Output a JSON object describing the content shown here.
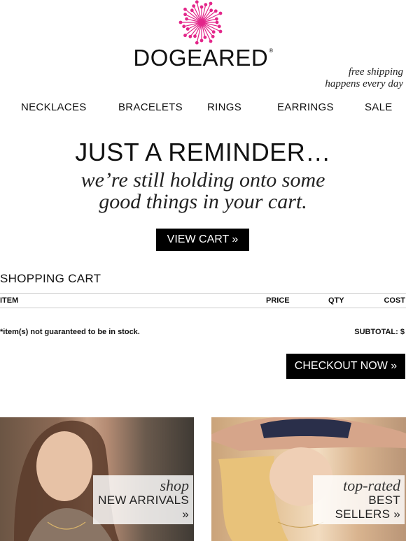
{
  "brand": {
    "name": "DOGEARED",
    "reg": "®",
    "accent": "#e3268a"
  },
  "shipping": {
    "line1": "free shipping",
    "line2": "happens every day"
  },
  "nav": [
    "NECKLACES",
    "BRACELETS",
    "RINGS",
    "EARRINGS",
    "SALE"
  ],
  "hero": {
    "title": "JUST A REMINDER…",
    "sub1": "we’re still holding onto some",
    "sub2": "good things in your cart.",
    "button": "VIEW CART »"
  },
  "cart": {
    "title": "SHOPPING CART",
    "columns": [
      "ITEM",
      "PRICE",
      "QTY",
      "COST"
    ],
    "footnote": "*item(s) not guaranteed to be in stock.",
    "subtotal": "SUBTOTAL: $",
    "checkout": "CHECKOUT NOW »"
  },
  "promos": [
    {
      "em": "shop",
      "label": "NEW ARRIVALS »"
    },
    {
      "em": "top-rated",
      "label": "BEST SELLERS »"
    }
  ]
}
